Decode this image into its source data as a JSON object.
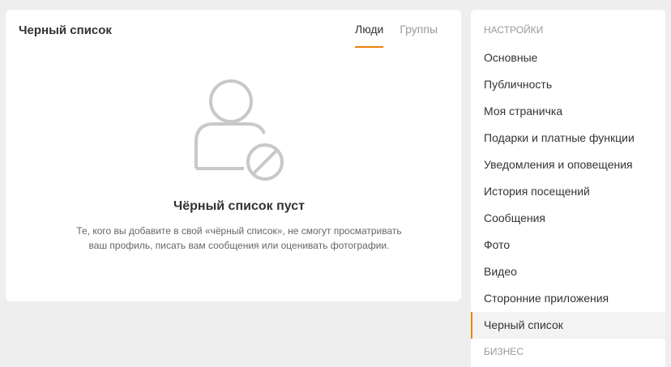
{
  "blacklist": {
    "title": "Черный список",
    "tabs": [
      {
        "label": "Люди",
        "active": true
      },
      {
        "label": "Группы",
        "active": false
      }
    ],
    "empty": {
      "icon": "blocked-user-icon",
      "title": "Чёрный список пуст",
      "text_line1": "Те, кого вы добавите в свой «чёрный список», не смогут просматривать",
      "text_line2": "ваш профиль, писать вам сообщения или оценивать фотографии."
    }
  },
  "sidebar": {
    "section_title": "Настройки",
    "items": [
      {
        "label": "Основные"
      },
      {
        "label": "Публичность"
      },
      {
        "label": "Моя страничка"
      },
      {
        "label": "Подарки и платные функции"
      },
      {
        "label": "Уведомления и оповещения"
      },
      {
        "label": "История посещений"
      },
      {
        "label": "Сообщения"
      },
      {
        "label": "Фото"
      },
      {
        "label": "Видео"
      },
      {
        "label": "Сторонние приложения"
      },
      {
        "label": "Черный список",
        "active": true
      }
    ],
    "section2_title": "Бизнес"
  },
  "colors": {
    "accent": "#ee8208",
    "background": "#eeeeee",
    "icon_gray": "#c8c8c8"
  }
}
